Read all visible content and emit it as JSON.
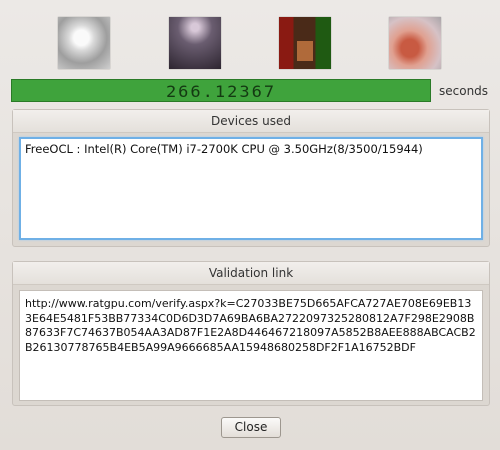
{
  "thumbnails": [
    {
      "name": "scene-render-1"
    },
    {
      "name": "scene-render-2"
    },
    {
      "name": "scene-render-3"
    },
    {
      "name": "scene-render-4"
    }
  ],
  "timer": {
    "value": "266.12367",
    "unit": "seconds",
    "bar_color": "#3fa33c"
  },
  "devices": {
    "title": "Devices used",
    "text": "FreeOCL : Intel(R) Core(TM) i7-2700K CPU @ 3.50GHz(8/3500/15944)"
  },
  "validation": {
    "title": "Validation link",
    "text": "http://www.ratgpu.com/verify.aspx?k=C27033BE75D665AFCA727AE708E69EB133E64E5481F53BB77334C0D6D3D7A69BA6BA2722097325280812A7F298E2908B87633F7C74637B054AA3AD87F1E2A8D446467218097A5852B8AEE888ABCACB2B26130778765B4EB5A99A9666685AA15948680258DF2F1A16752BDF"
  },
  "buttons": {
    "close_label": "Close"
  }
}
